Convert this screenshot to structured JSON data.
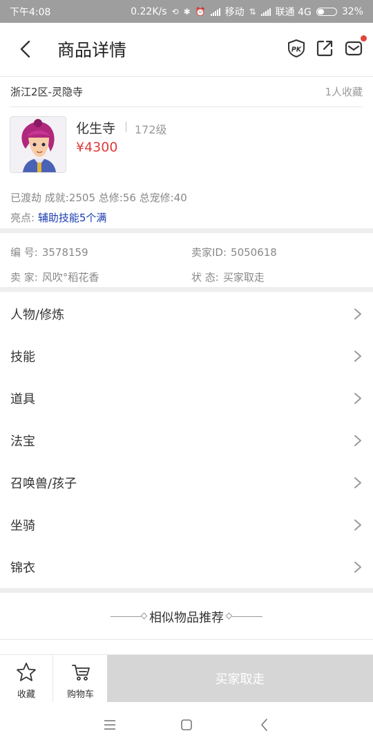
{
  "status_bar": {
    "time": "下午4:08",
    "speed": "0.22K/s",
    "carrier1": "移动",
    "carrier2": "联通 4G",
    "battery": "32%",
    "battery_level": 0.32
  },
  "header": {
    "title": "商品详情",
    "pk_icon_text": "PK"
  },
  "server": {
    "name": "浙江2区-灵隐寺",
    "fav_count": "1人收藏"
  },
  "character": {
    "name": "化生寺",
    "level": "172级",
    "price": "¥4300"
  },
  "achievements": "已渡劫 成就:2505 总修:56 总宠修:40",
  "highlight": {
    "label": "亮点: ",
    "value": "辅助技能5个满"
  },
  "info": {
    "id_label": "编  号:",
    "id_value": "3578159",
    "seller_id_label": "卖家ID:",
    "seller_id_value": "5050618",
    "seller_label": "卖  家:",
    "seller_value": "风吹°稻花香",
    "status_label": "状  态:",
    "status_value": "买家取走"
  },
  "menu": [
    {
      "label": "人物/修炼"
    },
    {
      "label": "技能"
    },
    {
      "label": "道具"
    },
    {
      "label": "法宝"
    },
    {
      "label": "召唤兽/孩子"
    },
    {
      "label": "坐骑"
    },
    {
      "label": "锦衣"
    }
  ],
  "similar": {
    "title": "相似物品推荐"
  },
  "bottom_bar": {
    "fav_label": "收藏",
    "cart_label": "购物车",
    "buy_label": "买家取走"
  },
  "colors": {
    "price": "#e03c3c",
    "highlight": "#1a3bb0",
    "status_bar": "#9e9e9e",
    "disabled_button": "#d6d6d6",
    "notification_dot": "#e0453a"
  }
}
